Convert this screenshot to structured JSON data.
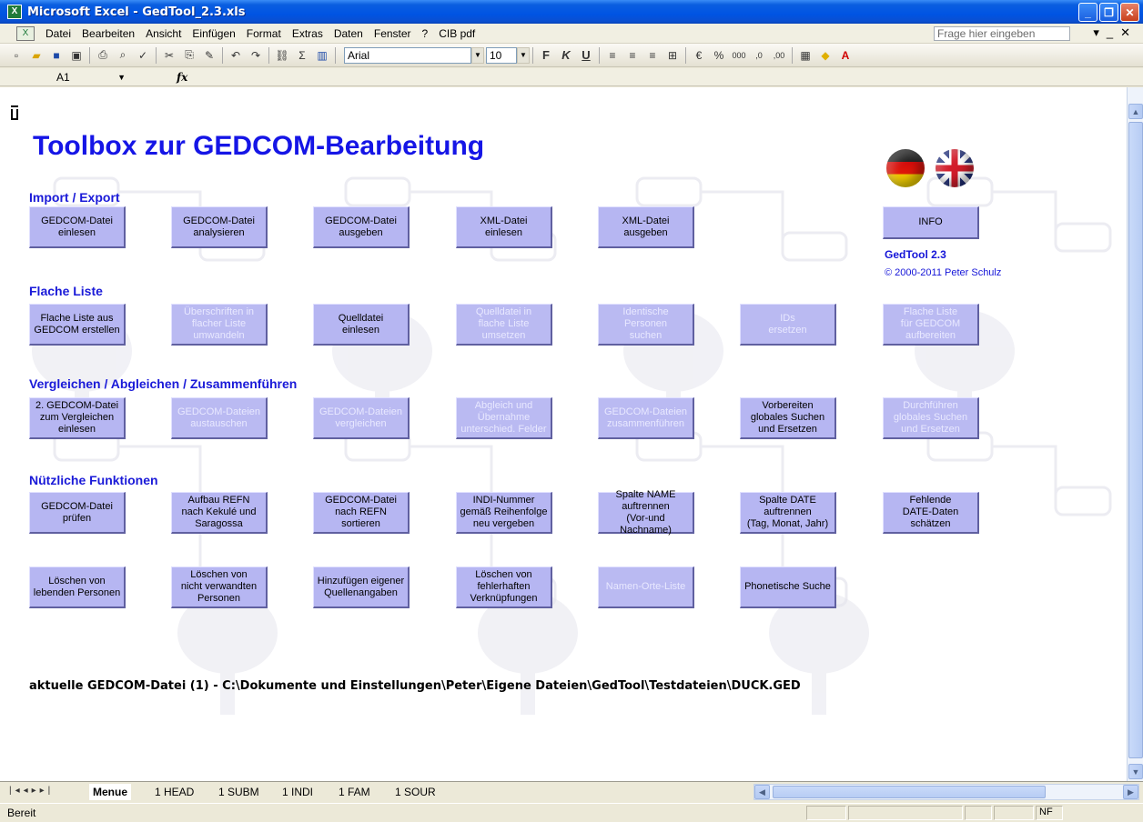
{
  "window": {
    "title": "Microsoft Excel - GedTool_2.3.xls",
    "app_icon": "excel-icon"
  },
  "menu": [
    "Datei",
    "Bearbeiten",
    "Ansicht",
    "Einfügen",
    "Format",
    "Extras",
    "Daten",
    "Fenster",
    "?",
    "CIB pdf"
  ],
  "menu_underline": [
    "D",
    "B",
    "A",
    "E",
    "t",
    "x",
    "n",
    "F",
    "?",
    ""
  ],
  "help_placeholder": "Frage hier eingeben",
  "toolbar": {
    "font_name": "Arial",
    "font_size": "10",
    "bold": "F",
    "italic": "K",
    "underline": "U"
  },
  "formula_bar": {
    "name_box": "A1",
    "fx": "fx"
  },
  "page": {
    "title": "Toolbox zur GEDCOM-Bearbeitung",
    "sections": {
      "import_export": "Import / Export",
      "flache_liste": "Flache Liste",
      "vergleichen": "Vergleichen / Abgleichen / Zusammenführen",
      "nuetzliche": "Nützliche Funktionen"
    },
    "buttons": {
      "import_export": [
        {
          "label": "GEDCOM-Datei\neinlesen",
          "enabled": true
        },
        {
          "label": "GEDCOM-Datei\nanalysieren",
          "enabled": true
        },
        {
          "label": "GEDCOM-Datei\nausgeben",
          "enabled": true
        },
        {
          "label": "XML-Datei\neinlesen",
          "enabled": true
        },
        {
          "label": "XML-Datei\nausgeben",
          "enabled": true
        }
      ],
      "info": {
        "label": "INFO",
        "enabled": true
      },
      "flache_liste": [
        {
          "label": "Flache Liste aus\nGEDCOM erstellen",
          "enabled": true
        },
        {
          "label": "Überschriften in\nflacher Liste\numwandeln",
          "enabled": false
        },
        {
          "label": "Quelldatei\neinlesen",
          "enabled": true
        },
        {
          "label": "Quelldatei in\nflache Liste\numsetzen",
          "enabled": false
        },
        {
          "label": "Identische Personen\nsuchen",
          "enabled": false
        },
        {
          "label": "IDs\nersetzen",
          "enabled": false
        },
        {
          "label": "Flache Liste\nfür GEDCOM\naufbereiten",
          "enabled": false
        }
      ],
      "vergleichen": [
        {
          "label": "2. GEDCOM-Datei\nzum Vergleichen\neinlesen",
          "enabled": true
        },
        {
          "label": "GEDCOM-Dateien\naustauschen",
          "enabled": false
        },
        {
          "label": "GEDCOM-Dateien\nvergleichen",
          "enabled": false
        },
        {
          "label": "Abgleich und\nÜbernahme\nunterschied. Felder",
          "enabled": false
        },
        {
          "label": "GEDCOM-Dateien\nzusammenführen",
          "enabled": false
        },
        {
          "label": "Vorbereiten\nglobales Suchen\nund Ersetzen",
          "enabled": true
        },
        {
          "label": "Durchführen\nglobales Suchen\nund Ersetzen",
          "enabled": false
        }
      ],
      "nuetzliche_row1": [
        {
          "label": "GEDCOM-Datei\nprüfen",
          "enabled": true
        },
        {
          "label": "Aufbau REFN\nnach Kekulé und\nSaragossa",
          "enabled": true
        },
        {
          "label": "GEDCOM-Datei\nnach REFN\nsortieren",
          "enabled": true
        },
        {
          "label": "INDI-Nummer\ngemäß Reihenfolge\nneu vergeben",
          "enabled": true
        },
        {
          "label": "Spalte NAME\nauftrennen\n(Vor-und Nachname)",
          "enabled": true
        },
        {
          "label": "Spalte DATE\nauftrennen\n(Tag, Monat, Jahr)",
          "enabled": true
        },
        {
          "label": "Fehlende\nDATE-Daten\nschätzen",
          "enabled": true
        }
      ],
      "nuetzliche_row2": [
        {
          "label": "Löschen von\nlebenden Personen",
          "enabled": true
        },
        {
          "label": "Löschen von\nnicht verwandten\nPersonen",
          "enabled": true
        },
        {
          "label": "Hinzufügen eigener\nQuellenangaben",
          "enabled": true
        },
        {
          "label": "Löschen von\nfehlerhaften\nVerknüpfungen",
          "enabled": true
        },
        {
          "label": "Namen-Orte-Liste",
          "enabled": false
        },
        {
          "label": "Phonetische Suche",
          "enabled": true
        }
      ]
    },
    "info_version": "GedTool 2.3",
    "info_copyright": "© 2000-2011  Peter Schulz",
    "current_file": "aktuelle GEDCOM-Datei (1) - C:\\Dokumente und Einstellungen\\Peter\\Eigene Dateien\\GedTool\\Testdateien\\DUCK.GED"
  },
  "sheet_tabs": [
    "Menue",
    "1 HEAD",
    "1 SUBM",
    "1 INDI",
    "1 FAM",
    "1 SOUR"
  ],
  "status": {
    "ready": "Bereit",
    "nf": "NF"
  },
  "colors": {
    "title": "#1515e6",
    "button": "#b6b6f2",
    "section": "#1a1ad8"
  }
}
